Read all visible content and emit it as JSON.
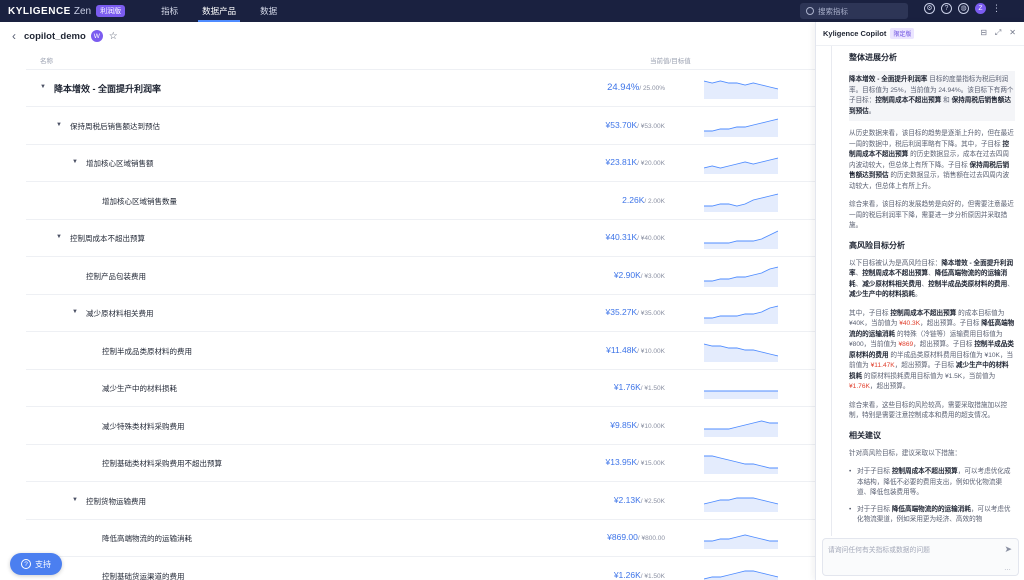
{
  "topbar": {
    "logo": "KYLIGENCE",
    "product": "Zen",
    "edition_badge": "利润版",
    "nav": [
      "指标",
      "数据产品",
      "数据"
    ],
    "active_nav": 1,
    "search_placeholder": "搜索指标",
    "avatar_initial": "Z",
    "icons": [
      "settings-icon",
      "help-icon",
      "globe-icon",
      "user-avatar",
      "more-icon"
    ]
  },
  "page": {
    "title": "copilot_demo",
    "avatar_initial": "W"
  },
  "table": {
    "col_name": "名称",
    "col_value": "当前值/目标值",
    "rows": [
      {
        "name": "降本增效 - 全面提升利润率",
        "current": "24.94%",
        "target": "/ 25.00%",
        "level": 0,
        "caret": true,
        "big": true,
        "trend": [
          8,
          7,
          8,
          7,
          7,
          6,
          7,
          6,
          5,
          4
        ]
      },
      {
        "name": "保持周税后销售额达到预估",
        "current": "¥53.70K",
        "target": "/ ¥53.00K",
        "level": 1,
        "caret": true,
        "trend": [
          2,
          2,
          3,
          3,
          4,
          4,
          5,
          6,
          7,
          8
        ]
      },
      {
        "name": "增加核心区域销售额",
        "current": "¥23.81K",
        "target": "/ ¥20.00K",
        "level": 2,
        "caret": true,
        "trend": [
          2,
          3,
          2,
          3,
          4,
          5,
          4,
          5,
          6,
          7
        ]
      },
      {
        "name": "增加核心区域销售数量",
        "current": "2.26K",
        "target": "/ 2.00K",
        "level": 3,
        "caret": false,
        "trend": [
          2,
          2,
          3,
          3,
          2,
          3,
          5,
          6,
          7,
          8
        ]
      },
      {
        "name": "控制周成本不超出预算",
        "current": "¥40.31K",
        "target": "/ ¥40.00K",
        "level": 1,
        "caret": true,
        "trend": [
          2,
          2,
          2,
          2,
          3,
          3,
          3,
          4,
          6,
          8
        ]
      },
      {
        "name": "控制产品包装费用",
        "current": "¥2.90K",
        "target": "/ ¥3.00K",
        "level": 2,
        "caret": false,
        "trend": [
          2,
          2,
          3,
          3,
          4,
          4,
          5,
          6,
          8,
          9
        ]
      },
      {
        "name": "减少原材料相关费用",
        "current": "¥35.27K",
        "target": "/ ¥35.00K",
        "level": 2,
        "caret": true,
        "trend": [
          2,
          2,
          3,
          3,
          3,
          4,
          4,
          5,
          7,
          8
        ]
      },
      {
        "name": "控制半成品类原材料的费用",
        "current": "¥11.48K",
        "target": "/ ¥10.00K",
        "level": 3,
        "caret": false,
        "trend": [
          8,
          7,
          7,
          6,
          6,
          5,
          5,
          4,
          3,
          2
        ]
      },
      {
        "name": "减少生产中的材料损耗",
        "current": "¥1.76K",
        "target": "/ ¥1.50K",
        "level": 3,
        "caret": false,
        "trend": [
          3,
          3,
          3,
          3,
          3,
          3,
          3,
          3,
          3,
          3
        ]
      },
      {
        "name": "减少特殊类材料采购费用",
        "current": "¥9.85K",
        "target": "/ ¥10.00K",
        "level": 3,
        "caret": false,
        "trend": [
          3,
          3,
          3,
          3,
          4,
          5,
          6,
          7,
          6,
          6
        ]
      },
      {
        "name": "控制基础类材料采购费用不超出预算",
        "current": "¥13.95K",
        "target": "/ ¥15.00K",
        "level": 3,
        "caret": false,
        "trend": [
          8,
          8,
          7,
          6,
          5,
          4,
          4,
          3,
          2,
          2
        ]
      },
      {
        "name": "控制货物运输费用",
        "current": "¥2.13K",
        "target": "/ ¥2.50K",
        "level": 2,
        "caret": true,
        "trend": [
          3,
          4,
          5,
          5,
          6,
          6,
          6,
          5,
          4,
          3
        ]
      },
      {
        "name": "降低高端物流的的运输消耗",
        "current": "¥869.00",
        "target": "/ ¥800.00",
        "level": 3,
        "caret": false,
        "trend": [
          3,
          3,
          4,
          4,
          5,
          6,
          5,
          4,
          3,
          3
        ]
      },
      {
        "name": "控制基础货运渠道的费用",
        "current": "¥1.26K",
        "target": "/ ¥1.50K",
        "level": 3,
        "caret": false,
        "trend": [
          3,
          4,
          4,
          5,
          6,
          7,
          7,
          6,
          5,
          4
        ]
      }
    ]
  },
  "support": {
    "label": "支持"
  },
  "copilot": {
    "title": "Kyligence Copilot",
    "badge": "限定版",
    "sec1_title": "整体进展分析",
    "sec1_p1": [
      {
        "b": "降本增效 - 全面提升利润率"
      },
      {
        "t": " 目标的度量指标为税后利润率。目标值为 25%，当前值为 24.94%。该目标下有两个子目标："
      },
      {
        "b": "控制周成本不超出预算"
      },
      {
        "t": " 和 "
      },
      {
        "b": "保持周税后销售额达到预估"
      },
      {
        "t": "。"
      }
    ],
    "sec1_p2": [
      {
        "t": "从历史数据来看，该目标的趋势是逐渐上升的，但在最近一周的数据中，税后利润率略有下降。其中，子目标 "
      },
      {
        "b": "控制周成本不超出预算"
      },
      {
        "t": " 的历史数据显示，成本在过去四周内波动较大，但总体上有所下降。子目标 "
      },
      {
        "b": "保持周税后销售额达到预估"
      },
      {
        "t": " 的历史数据显示，销售额在过去四周内波动较大，但总体上有所上升。"
      }
    ],
    "sec1_p3": "综合来看，该目标的发展趋势是向好的，但需要注意最近一周的税后利润率下降，需要进一步分析原因并采取措施。",
    "sec2_title": "高风险目标分析",
    "sec2_p1": [
      {
        "t": "以下目标被认为是高风险目标："
      },
      {
        "b": "降本增效 - 全面提升利润率"
      },
      {
        "t": "、"
      },
      {
        "b": "控制周成本不超出预算"
      },
      {
        "t": "、"
      },
      {
        "b": "降低高端物流的的运输消耗"
      },
      {
        "t": "、"
      },
      {
        "b": "减少原材料相关费用"
      },
      {
        "t": "、"
      },
      {
        "b": "控制半成品类原材料的费用"
      },
      {
        "t": "、"
      },
      {
        "b": "减少生产中的材料损耗"
      },
      {
        "t": "。"
      }
    ],
    "sec2_p2": [
      {
        "t": "其中，子目标 "
      },
      {
        "b": "控制周成本不超出预算"
      },
      {
        "t": " 的成本目标值为 ¥40K，当前值为 "
      },
      {
        "r": "¥40.3K"
      },
      {
        "t": "，超出预算。子目标 "
      },
      {
        "b": "降低高端物流的的运输消耗"
      },
      {
        "t": " 的特殊（冷链等）运输费用目标值为 ¥800，当前值为 "
      },
      {
        "r": "¥869"
      },
      {
        "t": "，超出预算。子目标 "
      },
      {
        "b": "控制半成品类原材料的费用"
      },
      {
        "t": " 的半成品类原材料费用目标值为 ¥10K，当前值为 "
      },
      {
        "r": "¥11.47K"
      },
      {
        "t": "，超出预算。子目标 "
      },
      {
        "b": "减少生产中的材料损耗"
      },
      {
        "t": " 的原材料损耗费用目标值为 ¥1.5K，当前值为 "
      },
      {
        "r": "¥1.76K"
      },
      {
        "t": "，超出预算。"
      }
    ],
    "sec2_p3": "综合来看，这些目标的风险较高，需要采取措施加以控制，特别是需要注意控制成本和费用的超支情况。",
    "sec3_title": "相关建议",
    "sec3_p1": "针对高风险目标，建议采取以下措施：",
    "sec3_li1": [
      {
        "t": "对于子目标 "
      },
      {
        "b": "控制周成本不超出预算"
      },
      {
        "t": "，可以考虑优化成本结构，降低不必要的费用支出，例如优化物流渠道、降低包装费用等。"
      }
    ],
    "sec3_li2": [
      {
        "t": "对于子目标 "
      },
      {
        "b": "降低高端物流的的运输消耗"
      },
      {
        "t": "，可以考虑优化物流渠道，例如采用更为经济、高效的物"
      }
    ],
    "input_placeholder": "请询问任何有关指标或数据的问题",
    "send_icon": "send-icon"
  }
}
